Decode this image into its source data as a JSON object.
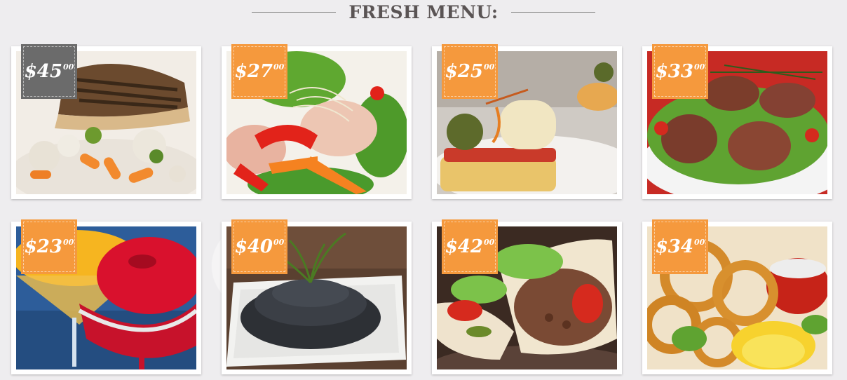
{
  "header": {
    "title": "FRESH MENU:"
  },
  "items": [
    {
      "amount": "$45",
      "cents": "00",
      "icon": "grilled-chicken-icon",
      "highlight": true
    },
    {
      "amount": "$27",
      "cents": "00",
      "icon": "salad-icon",
      "highlight": false
    },
    {
      "amount": "$25",
      "cents": "00",
      "icon": "canape-icon",
      "highlight": false
    },
    {
      "amount": "$33",
      "cents": "00",
      "icon": "sausage-salad-icon",
      "highlight": false
    },
    {
      "amount": "$23",
      "cents": "00",
      "icon": "sorbet-cocktail-icon",
      "highlight": false
    },
    {
      "amount": "$40",
      "cents": "00",
      "icon": "caviar-icon",
      "highlight": false
    },
    {
      "amount": "$42",
      "cents": "00",
      "icon": "burrito-wrap-icon",
      "highlight": false
    },
    {
      "amount": "$34",
      "cents": "00",
      "icon": "calamari-rings-icon",
      "highlight": false
    }
  ],
  "colors": {
    "accent": "#f5993d",
    "highlight": "#6b6b6b",
    "heading": "#5a5454"
  }
}
